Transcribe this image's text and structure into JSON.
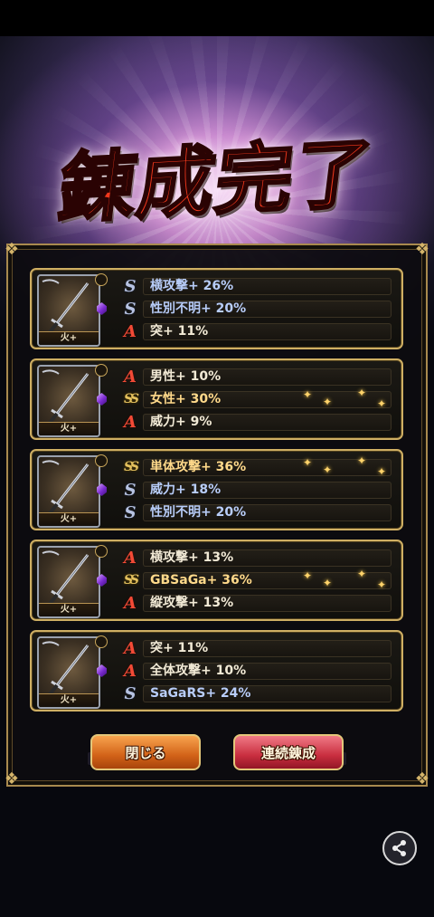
{
  "title": "錬成完了",
  "cards": [
    {
      "badge": "火+",
      "rows": [
        {
          "rank": "S",
          "text": "横攻撃+ 26%"
        },
        {
          "rank": "S",
          "text": "性別不明+ 20%"
        },
        {
          "rank": "A",
          "text": "突+ 11%"
        }
      ]
    },
    {
      "badge": "火+",
      "rows": [
        {
          "rank": "A",
          "text": "男性+ 10%"
        },
        {
          "rank": "SS",
          "text": "女性+ 30%"
        },
        {
          "rank": "A",
          "text": "威力+ 9%"
        }
      ]
    },
    {
      "badge": "火+",
      "rows": [
        {
          "rank": "SS",
          "text": "単体攻撃+ 36%"
        },
        {
          "rank": "S",
          "text": "威力+ 18%"
        },
        {
          "rank": "S",
          "text": "性別不明+ 20%"
        }
      ]
    },
    {
      "badge": "火+",
      "rows": [
        {
          "rank": "A",
          "text": "横攻撃+ 13%"
        },
        {
          "rank": "SS",
          "text": "GBSaGa+ 36%"
        },
        {
          "rank": "A",
          "text": "縦攻撃+ 13%"
        }
      ]
    },
    {
      "badge": "火+",
      "rows": [
        {
          "rank": "A",
          "text": "突+ 11%"
        },
        {
          "rank": "A",
          "text": "全体攻撃+ 10%"
        },
        {
          "rank": "S",
          "text": "SaGaRS+ 24%"
        }
      ]
    }
  ],
  "buttons": {
    "close": "閉じる",
    "continue": "連続錬成"
  },
  "icons": {
    "share": "share-icon",
    "weapon": "sword-icon",
    "gem": "gem-icon"
  },
  "colors": {
    "frame_gold": "#cfaf63",
    "title_red": "#f2381c",
    "rank_s": "#b7c3e2",
    "rank_a": "#f24a36",
    "rank_ss": "#e5c25f"
  }
}
